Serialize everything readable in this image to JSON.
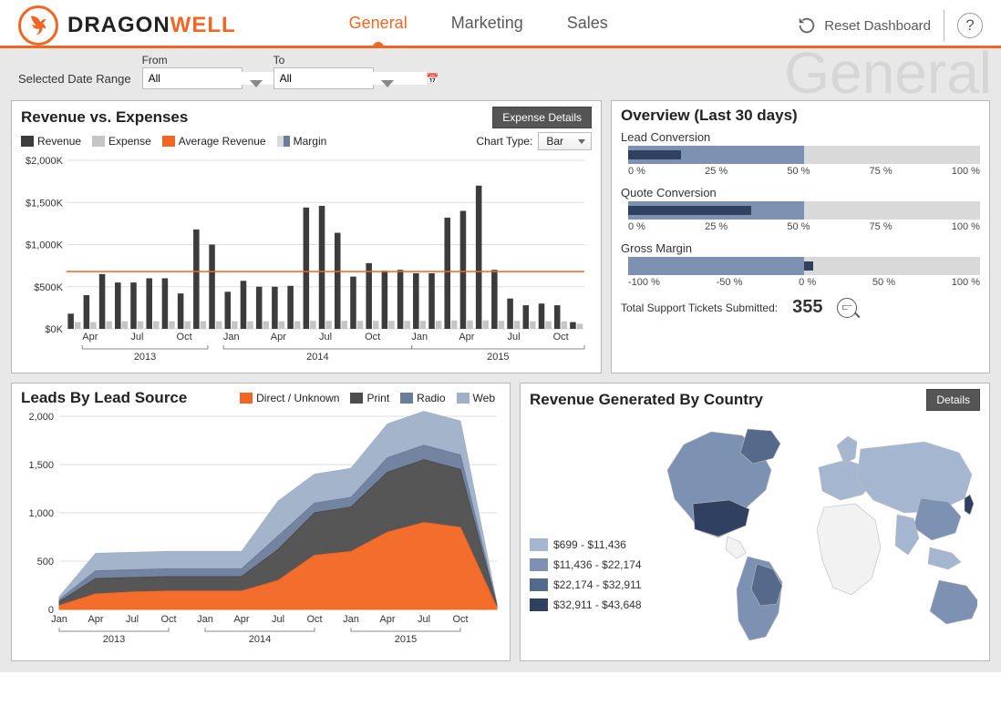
{
  "brand": {
    "first": "DRAGON",
    "second": "WELL"
  },
  "nav": {
    "items": [
      "General",
      "Marketing",
      "Sales"
    ],
    "active": "General"
  },
  "reset_label": "Reset Dashboard",
  "filter": {
    "title": "Selected Date Range",
    "from_label": "From",
    "to_label": "To",
    "from_value": "All",
    "to_value": "All"
  },
  "ghost": "General",
  "panels": {
    "rev": {
      "title": "Revenue vs. Expenses",
      "button": "Expense Details",
      "legend": [
        "Revenue",
        "Expense",
        "Average Revenue",
        "Margin"
      ],
      "chart_type_label": "Chart Type:",
      "chart_type_value": "Bar"
    },
    "ov": {
      "title": "Overview (Last 30 days)",
      "lead": "Lead Conversion",
      "quote": "Quote Conversion",
      "margin": "Gross Margin",
      "pct_scale": [
        "0 %",
        "25 %",
        "50 %",
        "75 %",
        "100 %"
      ],
      "margin_scale": [
        "-100 %",
        "-50 %",
        "0 %",
        "50 %",
        "100 %"
      ],
      "tickets_label": "Total Support Tickets Submitted:",
      "tickets_value": "355"
    },
    "leads": {
      "title": "Leads By Lead Source",
      "legend": [
        "Direct / Unknown",
        "Print",
        "Radio",
        "Web"
      ]
    },
    "map": {
      "title": "Revenue Generated By Country",
      "button": "Details",
      "legend": [
        "$699 - $11,436",
        "$11,436 - $22,174",
        "$22,174 - $32,911",
        "$32,911 - $43,648"
      ]
    }
  },
  "chart_data": [
    {
      "id": "revenue_vs_expenses",
      "type": "bar",
      "title": "Revenue vs. Expenses",
      "ylabel": "$K",
      "ylim": [
        0,
        2000
      ],
      "yticks": [
        "$0K",
        "$500K",
        "$1,000K",
        "$1,500K",
        "$2,000K"
      ],
      "categories": [
        "Mar 2013",
        "Apr 2013",
        "May 2013",
        "Jun 2013",
        "Jul 2013",
        "Aug 2013",
        "Sep 2013",
        "Oct 2013",
        "Nov 2013",
        "Dec 2013",
        "Jan 2014",
        "Feb 2014",
        "Mar 2014",
        "Apr 2014",
        "May 2014",
        "Jun 2014",
        "Jul 2014",
        "Aug 2014",
        "Sep 2014",
        "Oct 2014",
        "Nov 2014",
        "Dec 2014",
        "Jan 2015",
        "Feb 2015",
        "Mar 2015",
        "Apr 2015",
        "May 2015",
        "Jun 2015",
        "Jul 2015",
        "Aug 2015",
        "Sep 2015",
        "Oct 2015",
        "Nov 2015"
      ],
      "series": [
        {
          "name": "Revenue",
          "color": "#3c3c3c",
          "values": [
            180,
            400,
            650,
            550,
            550,
            600,
            600,
            420,
            1180,
            1000,
            440,
            570,
            500,
            500,
            510,
            1440,
            1460,
            1140,
            620,
            780,
            690,
            700,
            660,
            660,
            1320,
            1400,
            1700,
            700,
            360,
            280,
            300,
            280,
            80
          ]
        },
        {
          "name": "Expense",
          "color": "#c5c5c5",
          "values": [
            80,
            80,
            90,
            90,
            90,
            90,
            90,
            90,
            90,
            90,
            90,
            90,
            90,
            90,
            90,
            95,
            95,
            95,
            95,
            95,
            95,
            95,
            95,
            95,
            100,
            100,
            100,
            95,
            95,
            90,
            90,
            90,
            60
          ]
        }
      ],
      "reference_lines": [
        {
          "name": "Average Revenue",
          "color": "#f26522",
          "value": 680
        }
      ],
      "x_year_groups": [
        {
          "year": "2013",
          "span": [
            "Apr",
            "Oct"
          ]
        },
        {
          "year": "2014",
          "span": [
            "Jan",
            "Oct"
          ]
        },
        {
          "year": "2015",
          "span": [
            "Jan",
            "Oct"
          ]
        }
      ],
      "x_tick_labels": [
        "Apr",
        "Jul",
        "Oct",
        "Jan",
        "Apr",
        "Jul",
        "Oct",
        "Jan",
        "Apr",
        "Jul",
        "Oct"
      ]
    },
    {
      "id": "overview_bullets",
      "type": "bullet",
      "items": [
        {
          "name": "Lead Conversion",
          "range": [
            0,
            100
          ],
          "bands": [
            {
              "to": 50,
              "color": "#7d92b3"
            },
            {
              "to": 100,
              "color": "#d9d9d9"
            }
          ],
          "actual": 15
        },
        {
          "name": "Quote Conversion",
          "range": [
            0,
            100
          ],
          "bands": [
            {
              "to": 50,
              "color": "#7d92b3"
            },
            {
              "to": 100,
              "color": "#d9d9d9"
            }
          ],
          "actual": 35
        },
        {
          "name": "Gross Margin",
          "range": [
            -100,
            100
          ],
          "bands": [
            {
              "from": -100,
              "to": 0,
              "color": "#7d92b3"
            },
            {
              "from": 0,
              "to": 100,
              "color": "#d9d9d9"
            }
          ],
          "actual": 5,
          "actual_from": 0
        }
      ]
    },
    {
      "id": "leads_by_source",
      "type": "area",
      "title": "Leads By Lead Source",
      "stacked": true,
      "ylim": [
        0,
        2000
      ],
      "yticks": [
        0,
        500,
        1000,
        1500,
        2000
      ],
      "x": [
        "Jan 2013",
        "Apr 2013",
        "Jul 2013",
        "Oct 2013",
        "Jan 2014",
        "Apr 2014",
        "Jul 2014",
        "Oct 2014",
        "Jan 2015",
        "Apr 2015",
        "Jul 2015",
        "Oct 2015"
      ],
      "series": [
        {
          "name": "Direct / Unknown",
          "color": "#f26522",
          "values": [
            40,
            160,
            180,
            190,
            190,
            190,
            300,
            560,
            600,
            800,
            900,
            850,
            20
          ]
        },
        {
          "name": "Print",
          "color": "#4d4d4d",
          "values": [
            40,
            160,
            150,
            150,
            150,
            150,
            320,
            440,
            460,
            620,
            650,
            600,
            20
          ]
        },
        {
          "name": "Radio",
          "color": "#6b7d9b",
          "values": [
            20,
            80,
            80,
            80,
            80,
            80,
            140,
            100,
            100,
            150,
            150,
            150,
            10
          ]
        },
        {
          "name": "Web",
          "color": "#9fb0c8",
          "values": [
            30,
            180,
            180,
            180,
            180,
            180,
            360,
            300,
            300,
            350,
            350,
            350,
            10
          ]
        }
      ],
      "x_year_groups": [
        {
          "year": "2013"
        },
        {
          "year": "2014"
        },
        {
          "year": "2015"
        }
      ]
    },
    {
      "id": "revenue_by_country",
      "type": "choropleth",
      "title": "Revenue Generated By Country",
      "legend": [
        {
          "label": "$699 - $11,436",
          "color": "#a5b7d0"
        },
        {
          "label": "$11,436 - $22,174",
          "color": "#7d92b3"
        },
        {
          "label": "$22,174 - $32,911",
          "color": "#55698a"
        },
        {
          "label": "$32,911 - $43,648",
          "color": "#2f4060"
        }
      ]
    }
  ]
}
